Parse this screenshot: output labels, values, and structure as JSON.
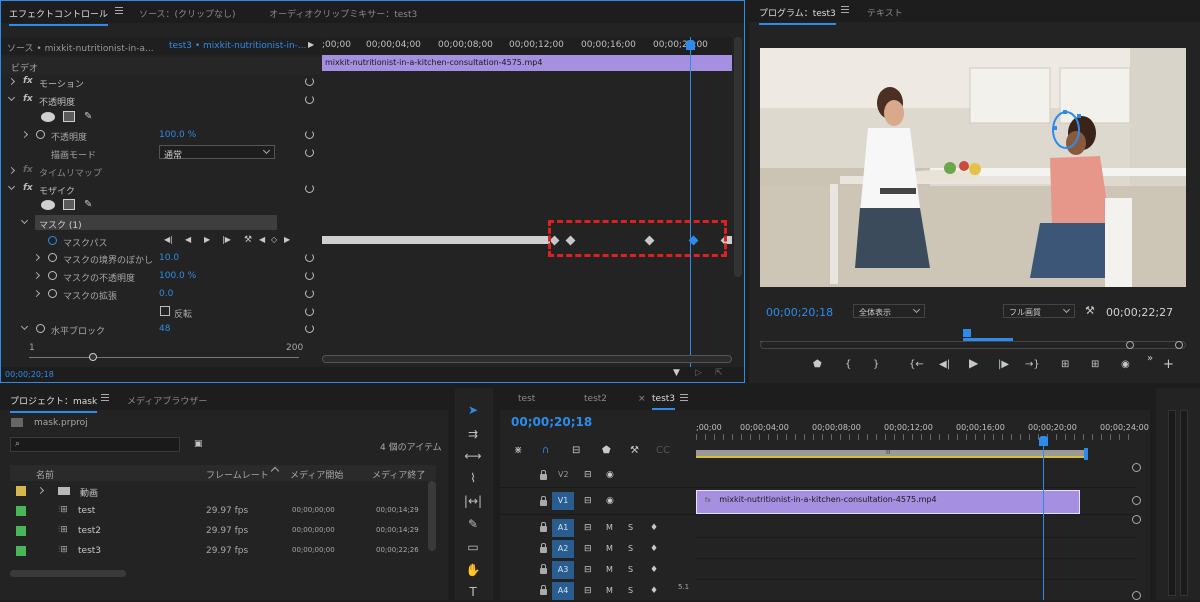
{
  "effect_panel": {
    "tabs": [
      "エフェクトコントロール",
      "ソース：(クリップなし)",
      "オーディオクリップミキサー：test3"
    ],
    "source_label": "ソース • mixkit-nutritionist-in-a...",
    "sequence_label": "test3 • mixkit-nutritionist-in-...",
    "timecodes": [
      ";00;00",
      "00;00;04;00",
      "00;00;08;00",
      "00;00;12;00",
      "00;00;16;00",
      "00;00;20;00"
    ],
    "clip_name": "mixkit-nutritionist-in-a-kitchen-consultation-4575.mp4",
    "video_header": "ビデオ",
    "motion": "モーション",
    "opacity": "不透明度",
    "opacity_label": "不透明度",
    "opacity_value": "100.0 %",
    "blend_label": "描画モード",
    "blend_value": "通常",
    "time_remap": "タイムリマップ",
    "mosaic": "モザイク",
    "mask": "マスク (1)",
    "mask_path": "マスクパス",
    "feather": "マスクの境界のぼかし",
    "feather_value": "10.0",
    "mask_opacity": "マスクの不透明度",
    "mask_opacity_value": "100.0 %",
    "expansion": "マスクの拡張",
    "expansion_value": "0.0",
    "invert": "反転",
    "h_blocks": "水平ブロック",
    "h_blocks_value": "48",
    "slider_min": "1",
    "slider_max": "200",
    "current_time": "00;00;20;18"
  },
  "program": {
    "tabs": [
      "プログラム：test3",
      "テキスト"
    ],
    "timecode": "00;00;20;18",
    "zoom": "全体表示",
    "quality": "フル画質",
    "duration": "00;00;22;27"
  },
  "project": {
    "tabs": [
      "プロジェクト：mask",
      "メディアブラウザー"
    ],
    "file": "mask.prproj",
    "item_count": "4 個のアイテム",
    "columns": [
      "名前",
      "フレームレート",
      "メディア開始",
      "メディア終了"
    ],
    "items": [
      {
        "name": "動画",
        "fps": "",
        "start": "",
        "end": "",
        "color": "#d6b84a",
        "type": "folder"
      },
      {
        "name": "test",
        "fps": "29.97 fps",
        "start": "00;00;00;00",
        "end": "00;00;14;29",
        "color": "#4ab65a",
        "type": "seq"
      },
      {
        "name": "test2",
        "fps": "29.97 fps",
        "start": "00;00;00;00",
        "end": "00;00;14;29",
        "color": "#4ab65a",
        "type": "seq"
      },
      {
        "name": "test3",
        "fps": "29.97 fps",
        "start": "00;00;00;00",
        "end": "00;00;22;26",
        "color": "#4ab65a",
        "type": "seq"
      }
    ]
  },
  "timeline": {
    "tabs": [
      "test",
      "test2",
      "test3"
    ],
    "close_mark": "×",
    "timecode": "00;00;20;18",
    "ruler": [
      ";00;00",
      "00;00;04;00",
      "00;00;08;00",
      "00;00;12;00",
      "00;00;16;00",
      "00;00;20;00",
      "00;00;24;00"
    ],
    "tracks_video": [
      "V2",
      "V1"
    ],
    "tracks_audio": [
      "A1",
      "A2",
      "A3",
      "A4"
    ],
    "clip_name": "mixkit-nutritionist-in-a-kitchen-consultation-4575.mp4",
    "clip_fx": "fx",
    "m_label": "M",
    "s_label": "S",
    "audio_level": "5.1"
  },
  "colors": {
    "accent": "#2d8ceb",
    "clip": "#a48fe0",
    "highlight": "#e02020"
  }
}
